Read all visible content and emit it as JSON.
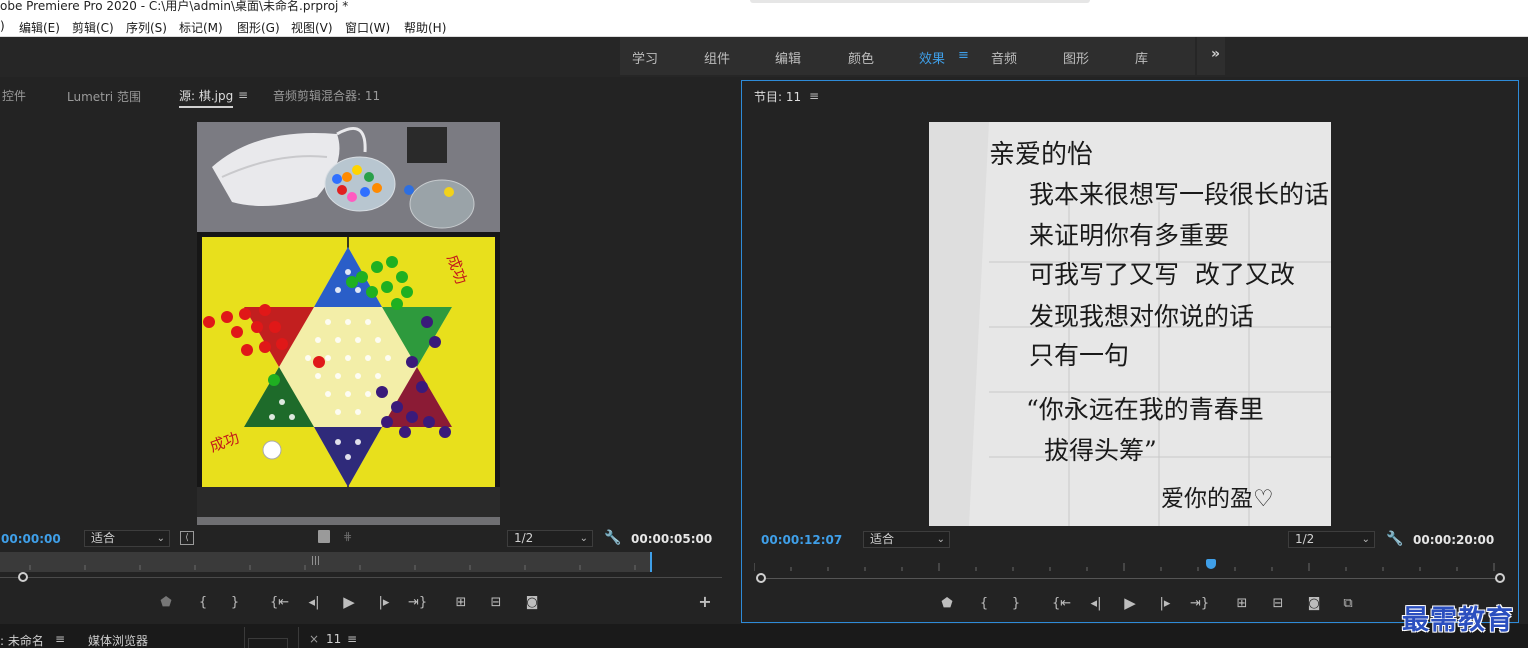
{
  "window": {
    "title": "obe Premiere Pro 2020 - C:\\用户\\admin\\桌面\\未命名.prproj *"
  },
  "menu": [
    ")",
    "编辑(E)",
    "剪辑(C)",
    "序列(S)",
    "标记(M)",
    "图形(G)",
    "视图(V)",
    "窗口(W)",
    "帮助(H)"
  ],
  "workspaces": {
    "items": [
      "学习",
      "组件",
      "编辑",
      "颜色",
      "效果",
      "音频",
      "图形",
      "库"
    ],
    "active": "效果",
    "menu_icon": "≡",
    "more_icon": "»"
  },
  "source_panel": {
    "tabs": [
      "控件",
      "Lumetri 范围",
      "源: 棋.jpg",
      "音频剪辑混合器: 11"
    ],
    "active_tab": "源: 棋.jpg",
    "menu_icon": "≡",
    "timecode_current": "00:00:00",
    "fit": "适合",
    "resolution": "1/2",
    "timecode_duration": "00:00:05:00",
    "image_icon": "chinese-checkers-board-photo"
  },
  "program_panel": {
    "tab": "节目: 11",
    "menu_icon": "≡",
    "timecode_current": "00:00:12:07",
    "fit": "适合",
    "resolution": "1/2",
    "timecode_duration": "00:00:20:00",
    "playhead_fraction": 0.61,
    "note": {
      "lines": [
        "亲爱的怡",
        "我本来很想写一段很长的话",
        "来证明你有多重要",
        "可我写了又写  改了又改",
        "发现我想对你说的话",
        "只有一句",
        "“你永远在我的青春里",
        "拔得头筹”",
        "爱你的盈♡"
      ]
    }
  },
  "bottom": {
    "project_tab": ": 未命名",
    "media_browser": "媒体浏览器",
    "timeline_tab": "11",
    "close": "×",
    "menu_icon": "≡"
  },
  "watermark": "最需教育",
  "colors": {
    "accent": "#3f9fe8",
    "panel_border": "#2e8bd8",
    "watermark": "#2b4fbf"
  }
}
